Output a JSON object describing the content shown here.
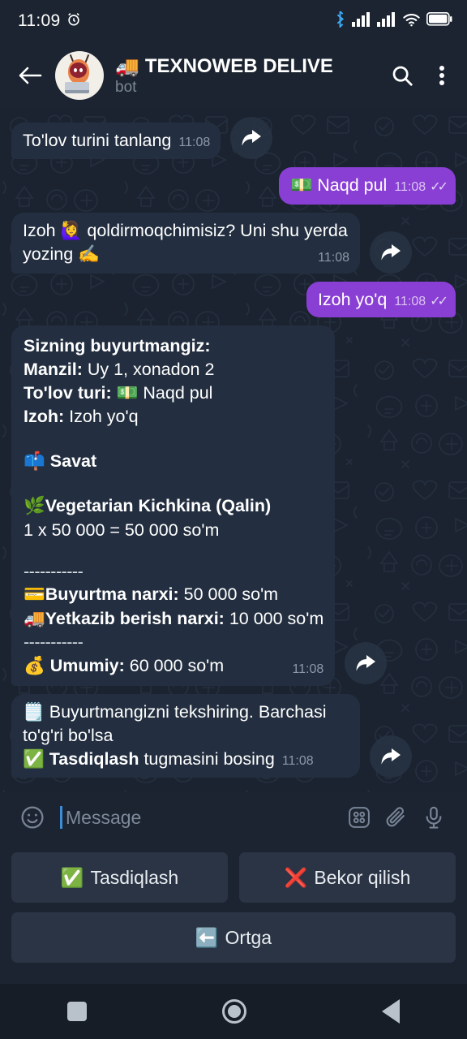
{
  "status_bar": {
    "clock": "11:09",
    "icons": [
      "alarm-icon",
      "bluetooth-icon",
      "signal-1-icon",
      "signal-2-icon",
      "wifi-icon",
      "battery-icon"
    ]
  },
  "header": {
    "back_icon": "back-arrow-icon",
    "avatar": "bot-avatar",
    "title_emoji": "🚚",
    "title": "TEXNOWEB DELIVE",
    "subtitle": "bot",
    "search_icon": "search-icon",
    "menu_icon": "kebab-menu-icon"
  },
  "messages": [
    {
      "id": "m1",
      "direction": "in",
      "text": "To'lov turini tanlang",
      "time": "11:08",
      "forward": true
    },
    {
      "id": "m2",
      "direction": "out",
      "emoji": "💵",
      "text": "Naqd pul",
      "time": "11:08",
      "ticks": "✓✓"
    },
    {
      "id": "m3",
      "direction": "in",
      "text_part1": "Izoh ",
      "emoji1": "🙋‍♀️",
      "text_part2": " qoldirmoqchimisiz? Uni shu yerda yozing ",
      "emoji2": "✍️",
      "time": "11:08",
      "forward": true
    },
    {
      "id": "m4",
      "direction": "out",
      "text": "Izoh yo'q",
      "time": "11:08",
      "ticks": "✓✓"
    }
  ],
  "order_summary": {
    "heading": "Sizning buyurtmangiz:",
    "address_label": "Manzil:",
    "address_value": "Uy 1, xonadon 2",
    "payment_label": "To'lov turi:",
    "payment_emoji": "💵",
    "payment_value": "Naqd pul",
    "note_label": "Izoh:",
    "note_value": "Izoh yo'q",
    "cart_emoji": "📫",
    "cart_label": "Savat",
    "item_emoji": "🌿",
    "item_name": "Vegetarian Kichkina (Qalin)",
    "item_line": "1 x 50 000 = 50 000 so'm",
    "divider1": "-----------",
    "order_price_emoji": "💳",
    "order_price_label": "Buyurtma narxi:",
    "order_price_value": "50 000 so'm",
    "delivery_emoji": "🚚",
    "delivery_label": "Yetkazib berish narxi:",
    "delivery_value": "10 000  so'm",
    "divider2": "-----------",
    "total_emoji": "💰",
    "total_label": "Umumiy:",
    "total_value": "60 000 so'm",
    "time": "11:08",
    "forward": true
  },
  "check_message": {
    "emoji": "🗒️",
    "line1": " Buyurtmangizni tekshiring. Barchasi to'g'ri bo'lsa",
    "check_emoji": "✅",
    "confirm_word": "Tasdiqlash",
    "line2_rest": " tugmasini bosing",
    "time": "11:08",
    "forward": true
  },
  "composer": {
    "smiley_icon": "emoji-smiley-icon",
    "placeholder": "Message",
    "value": "",
    "bot_menu_icon": "bot-commands-grid-icon",
    "attach_icon": "paperclip-icon",
    "mic_icon": "microphone-icon"
  },
  "reply_keyboard": {
    "rows": [
      [
        {
          "emoji": "✅",
          "label": "Tasdiqlash",
          "name": "confirm"
        },
        {
          "emoji": "❌",
          "label": "Bekor qilish",
          "name": "cancel"
        }
      ],
      [
        {
          "emoji": "⬅️",
          "label": "Ortga",
          "name": "back"
        }
      ]
    ]
  },
  "nav_bar": {
    "recents_icon": "recents-square-icon",
    "home_icon": "home-circle-icon",
    "back_icon": "back-triangle-icon"
  },
  "colors": {
    "app_bg": "#1b2430",
    "chat_bg": "#1b2330",
    "bubble_in": "#232f40",
    "bubble_out": "#8a3fd4",
    "keyboard_btn": "#2a3444",
    "nav_bg": "#161d27",
    "accent_blue": "#3e8bd8",
    "muted_text": "#8d99a8"
  }
}
